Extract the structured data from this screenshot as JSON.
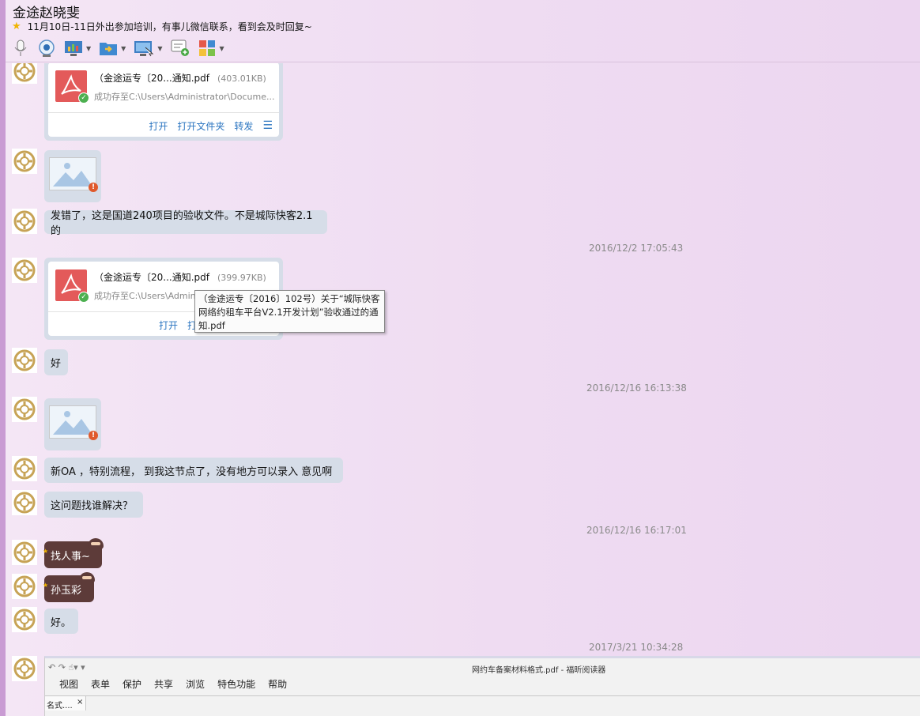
{
  "window": {
    "title": "金途赵晓斐",
    "signature": "11月10日-11日外出参加培训，有事儿微信联系，看到会及时回复~"
  },
  "toolbar": {
    "items": [
      {
        "icon": "microphone-icon"
      },
      {
        "icon": "webcam-icon"
      },
      {
        "icon": "screen-share-icon"
      },
      {
        "icon": "file-transfer-icon"
      },
      {
        "icon": "remote-desktop-icon"
      },
      {
        "icon": "new-chat-icon"
      },
      {
        "icon": "apps-icon"
      }
    ]
  },
  "messages": {
    "file1": {
      "name": "（金途运专〔20...通知.pdf",
      "size": "(403.01KB)",
      "status": "成功存至C:\\Users\\Administrator\\Docume...",
      "open": "打开",
      "open_folder": "打开文件夹",
      "forward": "转发"
    },
    "m3": "发错了，这是国道240项目的验收文件。不是城际快客2.1的",
    "ts1": "2016/12/2 17:05:43",
    "file2": {
      "name": "（金途运专〔20...通知.pdf",
      "size": "(399.97KB)",
      "status": "成功存至C:\\Users\\Adminis",
      "open": "打开",
      "open_folder": "打开"
    },
    "tooltip": "（金途运专〔2016〕102号）关于“城际快客网络约租车平台V2.1开发计划”验收通过的通知.pdf",
    "m6": "好",
    "ts2": "2016/12/16 16:13:38",
    "m8": "新OA ，特别流程， 到我这节点了，没有地方可以录入 意见啊",
    "m9": "这问题找谁解决？",
    "ts3": "2016/12/16 16:17:01",
    "m10": "找人事~",
    "m11": "孙玉彩",
    "m12": "好。",
    "ts4": "2017/3/21 10:34:28"
  },
  "reader": {
    "title": "网约车备案材料格式.pdf - 福昕阅读器",
    "menu": [
      "视图",
      "表单",
      "保护",
      "共享",
      "浏览",
      "特色功能",
      "帮助"
    ],
    "tab": "名式....",
    "tab_close": "×"
  },
  "colors": {
    "bubble": "#d6dde8",
    "link": "#2a74c0",
    "pdf": "#e35a5a",
    "emoticon_bubble": "#5d3b39"
  }
}
